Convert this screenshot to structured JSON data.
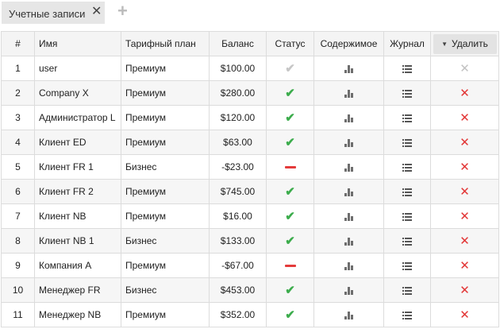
{
  "tabs": [
    {
      "label": "Учетные записи",
      "close_glyph": "✕"
    }
  ],
  "add_tab_glyph": "+",
  "columns": {
    "num": "#",
    "name": "Имя",
    "plan": "Тарифный план",
    "balance": "Баланс",
    "status": "Статус",
    "content": "Содержимое",
    "journal": "Журнал",
    "delete": "Удалить"
  },
  "status_colors": {
    "active": "#3cac4c",
    "blocked": "#e43b3b",
    "disabled": "#c6c6c6"
  },
  "rows": [
    {
      "num": "1",
      "name": "user",
      "plan": "Премиум",
      "balance": "$100.00",
      "status": "disabled",
      "deletable": false
    },
    {
      "num": "2",
      "name": "Company X",
      "plan": "Премиум",
      "balance": "$280.00",
      "status": "active",
      "deletable": true
    },
    {
      "num": "3",
      "name": "Администратор L",
      "plan": "Премиум",
      "balance": "$120.00",
      "status": "active",
      "deletable": true
    },
    {
      "num": "4",
      "name": "Клиент ED",
      "plan": "Премиум",
      "balance": "$63.00",
      "status": "active",
      "deletable": true
    },
    {
      "num": "5",
      "name": "Клиент FR 1",
      "plan": "Бизнес",
      "balance": "-$23.00",
      "status": "blocked",
      "deletable": true
    },
    {
      "num": "6",
      "name": "Клиент FR 2",
      "plan": "Премиум",
      "balance": "$745.00",
      "status": "active",
      "deletable": true
    },
    {
      "num": "7",
      "name": "Клиент NB",
      "plan": "Премиум",
      "balance": "$16.00",
      "status": "active",
      "deletable": true
    },
    {
      "num": "8",
      "name": "Клиент NB 1",
      "plan": "Бизнес",
      "balance": "$133.00",
      "status": "active",
      "deletable": true
    },
    {
      "num": "9",
      "name": "Компания А",
      "plan": "Премиум",
      "balance": "-$67.00",
      "status": "blocked",
      "deletable": true
    },
    {
      "num": "10",
      "name": "Менеджер FR",
      "plan": "Бизнес",
      "balance": "$453.00",
      "status": "active",
      "deletable": true
    },
    {
      "num": "11",
      "name": "Менеджер NB",
      "plan": "Премиум",
      "balance": "$352.00",
      "status": "active",
      "deletable": true
    }
  ]
}
